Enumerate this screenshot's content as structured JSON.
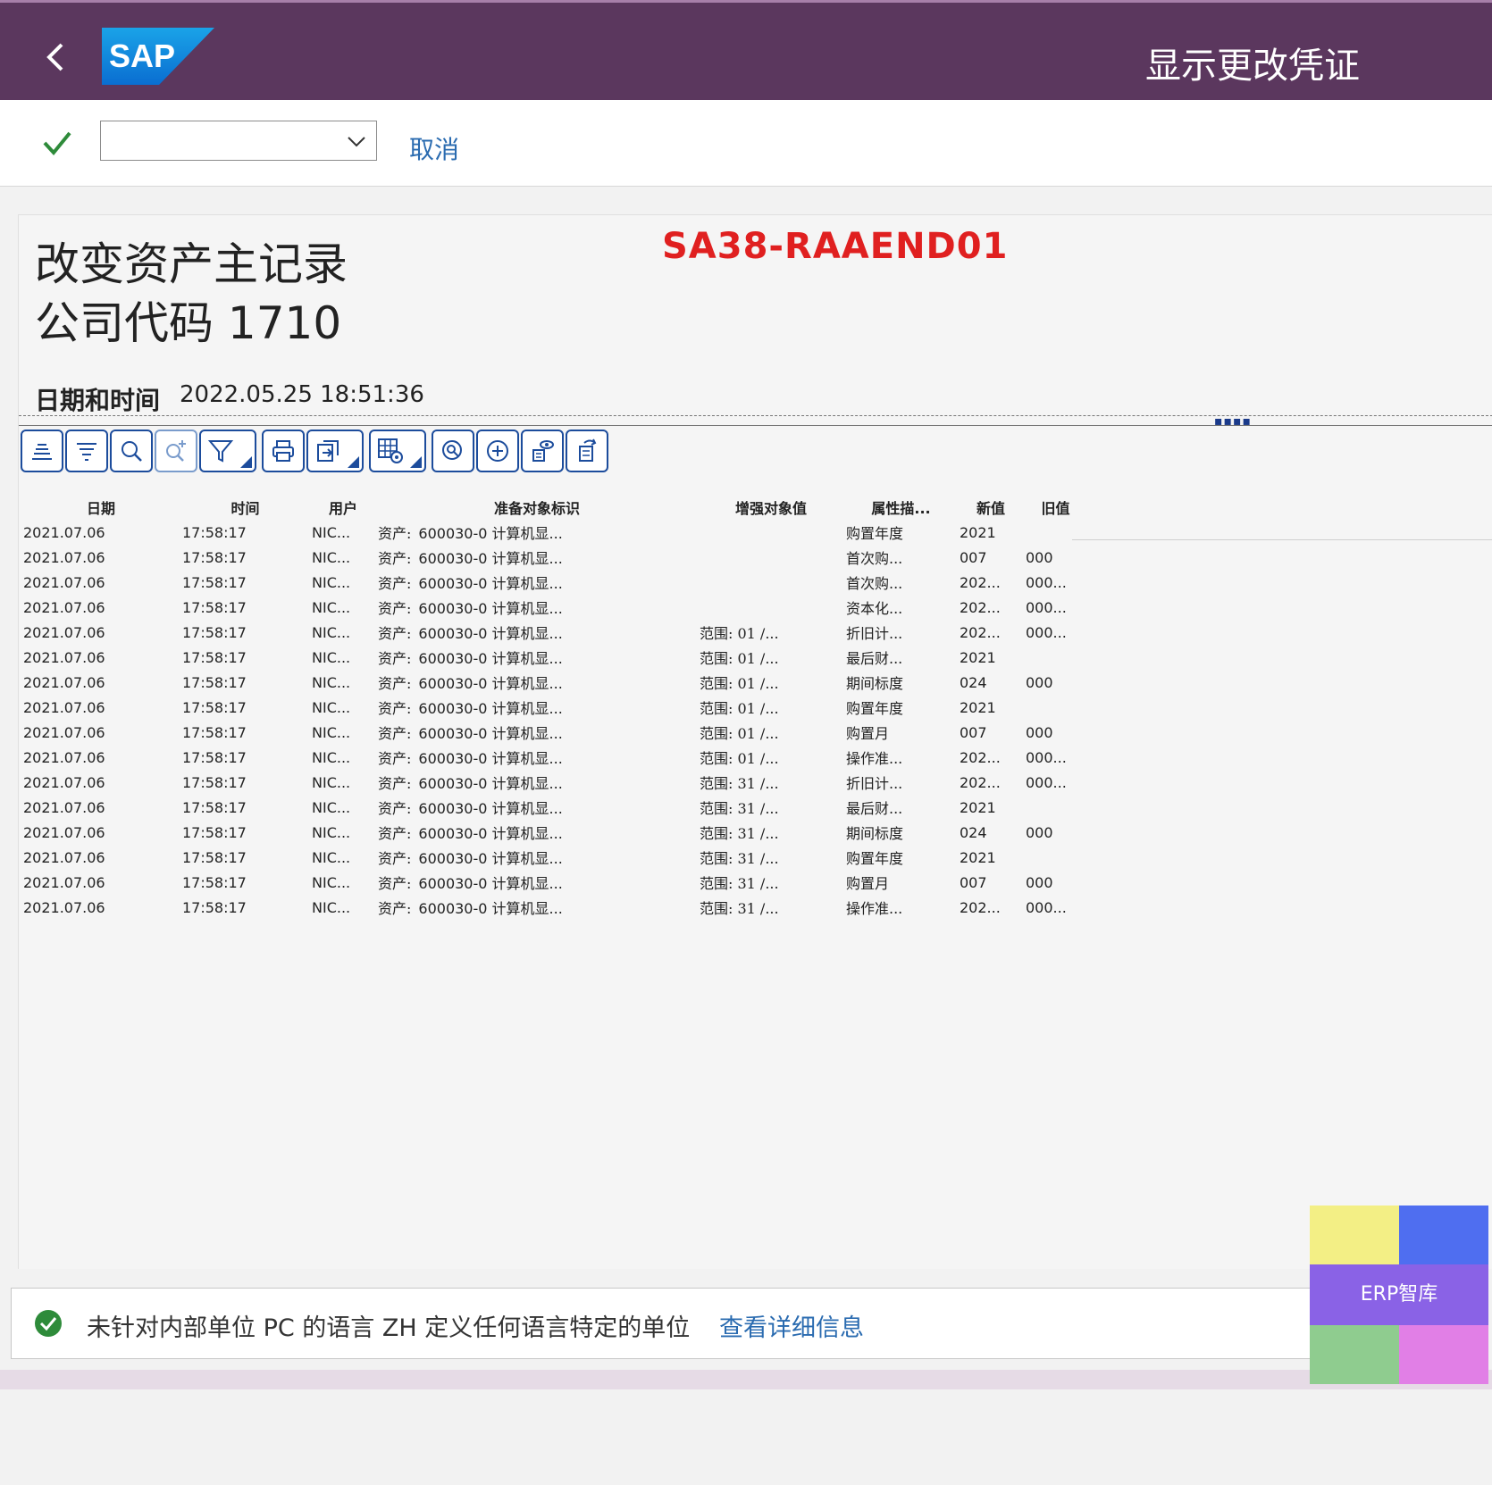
{
  "header": {
    "app_title": "显示更改凭证",
    "back_icon": "chevron-left-icon",
    "logo_text": "SAP"
  },
  "actionbar": {
    "command_value": "",
    "cancel_label": "取消"
  },
  "report": {
    "title_line1": "改变资产主记录",
    "title_line2": "公司代码 1710",
    "overlay_code": "SA38-RAAEND01",
    "datetime_label": "日期和时间",
    "datetime_value": "2022.05.25 18:51:36"
  },
  "toolbar": {
    "buttons": [
      "align-center-icon",
      "filter-list-icon",
      "search-icon",
      "search-next-icon",
      "filter-icon",
      "print-icon",
      "export-icon",
      "layout-settings-icon",
      "zoom-detail-icon",
      "add-icon",
      "view-details-icon",
      "refresh-icon"
    ]
  },
  "grid": {
    "columns": [
      "日期",
      "时间",
      "用户",
      "准备对象标识",
      "增强对象值",
      "属性描...",
      "新值",
      "旧值"
    ],
    "rows": [
      [
        "2021.07.06",
        "17:58:17",
        "NIC...",
        "600030-0 计算机显...",
        "",
        "购置年度",
        "2021",
        ""
      ],
      [
        "2021.07.06",
        "17:58:17",
        "NIC...",
        "600030-0 计算机显...",
        "",
        "首次购...",
        "007",
        "000"
      ],
      [
        "2021.07.06",
        "17:58:17",
        "NIC...",
        "600030-0 计算机显...",
        "",
        "首次购...",
        "202...",
        "000..."
      ],
      [
        "2021.07.06",
        "17:58:17",
        "NIC...",
        "600030-0 计算机显...",
        "",
        "资本化...",
        "202...",
        "000..."
      ],
      [
        "2021.07.06",
        "17:58:17",
        "NIC...",
        "600030-0 计算机显...",
        "范围: 01 /...",
        "折旧计...",
        "202...",
        "000..."
      ],
      [
        "2021.07.06",
        "17:58:17",
        "NIC...",
        "600030-0 计算机显...",
        "范围: 01 /...",
        "最后财...",
        "2021",
        ""
      ],
      [
        "2021.07.06",
        "17:58:17",
        "NIC...",
        "600030-0 计算机显...",
        "范围: 01 /...",
        "期间标度",
        "024",
        "000"
      ],
      [
        "2021.07.06",
        "17:58:17",
        "NIC...",
        "600030-0 计算机显...",
        "范围: 01 /...",
        "购置年度",
        "2021",
        ""
      ],
      [
        "2021.07.06",
        "17:58:17",
        "NIC...",
        "600030-0 计算机显...",
        "范围: 01 /...",
        "购置月",
        "007",
        "000"
      ],
      [
        "2021.07.06",
        "17:58:17",
        "NIC...",
        "600030-0 计算机显...",
        "范围: 01 /...",
        "操作准...",
        "202...",
        "000..."
      ],
      [
        "2021.07.06",
        "17:58:17",
        "NIC...",
        "600030-0 计算机显...",
        "范围: 31 /...",
        "折旧计...",
        "202...",
        "000..."
      ],
      [
        "2021.07.06",
        "17:58:17",
        "NIC...",
        "600030-0 计算机显...",
        "范围: 31 /...",
        "最后财...",
        "2021",
        ""
      ],
      [
        "2021.07.06",
        "17:58:17",
        "NIC...",
        "600030-0 计算机显...",
        "范围: 31 /...",
        "期间标度",
        "024",
        "000"
      ],
      [
        "2021.07.06",
        "17:58:17",
        "NIC...",
        "600030-0 计算机显...",
        "范围: 31 /...",
        "购置年度",
        "2021",
        ""
      ],
      [
        "2021.07.06",
        "17:58:17",
        "NIC...",
        "600030-0 计算机显...",
        "范围: 31 /...",
        "购置月",
        "007",
        "000"
      ],
      [
        "2021.07.06",
        "17:58:17",
        "NIC...",
        "600030-0 计算机显...",
        "范围: 31 /...",
        "操作准...",
        "202...",
        "000..."
      ]
    ],
    "object_prefix": "资产:"
  },
  "message": {
    "text": "未针对内部单位 PC 的语言 ZH 定义任何语言特定的单位",
    "link": "查看详细信息"
  },
  "badge": {
    "text": "ERP智库",
    "colors": [
      "#f3ef85",
      "#4f6ef0",
      "#8fcc8f",
      "#e17fe6"
    ]
  },
  "colors": {
    "shell": "#5b375e",
    "link": "#2a6bb0",
    "toolbar_border": "#1c4c9c",
    "selected_cell": "#d4e5f7",
    "success": "#2e8b3a",
    "overlay_red": "#e02020"
  }
}
